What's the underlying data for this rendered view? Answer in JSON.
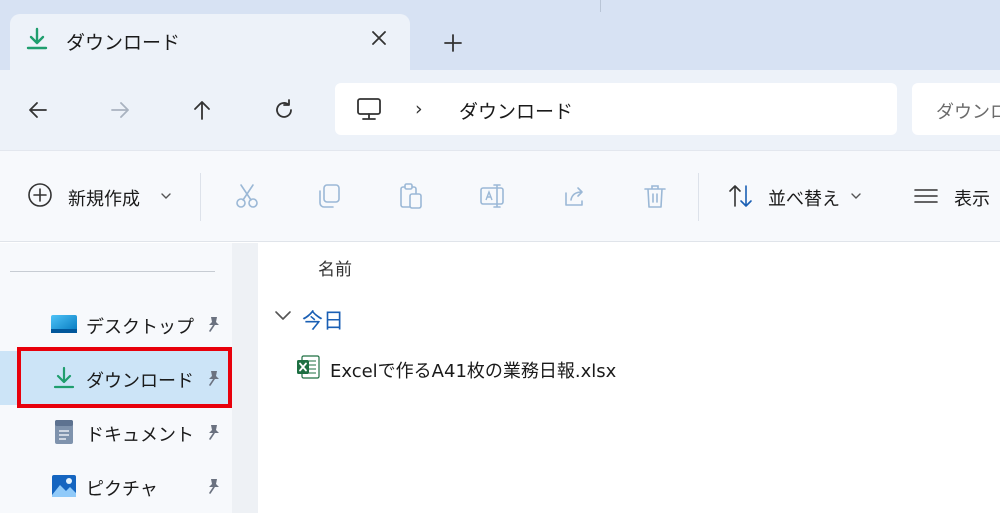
{
  "tab": {
    "title": "ダウンロード"
  },
  "address": {
    "crumb_separator": "›",
    "crumb": "ダウンロード"
  },
  "search": {
    "placeholder": "ダウンロ"
  },
  "toolbar": {
    "new_label": "新規作成",
    "sort_label": "並べ替え",
    "view_label": "表示"
  },
  "sidebar": {
    "items": [
      {
        "label": "デスクトップ",
        "icon": "desktop-icon"
      },
      {
        "label": "ダウンロード",
        "icon": "download-icon"
      },
      {
        "label": "ドキュメント",
        "icon": "documents-icon"
      },
      {
        "label": "ピクチャ",
        "icon": "pictures-icon"
      }
    ]
  },
  "list": {
    "column_name": "名前",
    "group": "今日",
    "files": [
      {
        "name": "Excelで作るA41枚の業務日報.xlsx",
        "icon": "excel-file-icon"
      }
    ]
  },
  "colors": {
    "accent": "#1a5fb4",
    "selection": "#cce4f7",
    "highlight": "#e8000b",
    "download_green": "#1f9e6e"
  }
}
